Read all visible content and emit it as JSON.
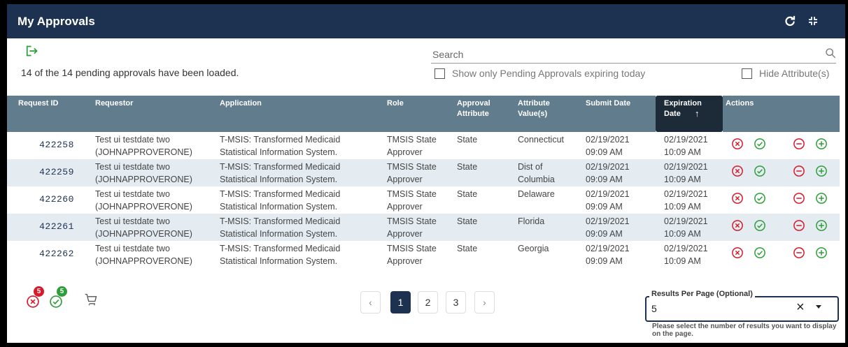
{
  "header": {
    "title": "My Approvals",
    "refresh_icon": "refresh-icon",
    "collapse_icon": "collapse-icon"
  },
  "toolbar": {
    "loaded_text": "14 of the 14 pending approvals have been loaded.",
    "search_placeholder": "Search",
    "search_value": "",
    "expiring_today_label": "Show only Pending Approvals expiring today",
    "expiring_today_checked": false,
    "hide_attributes_label": "Hide Attribute(s)",
    "hide_attributes_checked": false
  },
  "table": {
    "columns": [
      "Request ID",
      "Requestor",
      "Application",
      "Role",
      "Approval Attribute",
      "Attribute Value(s)",
      "Submit Date",
      "Expiration Date",
      "Actions"
    ],
    "sort": {
      "column": "Expiration Date",
      "direction": "ascending",
      "indicator": "↑"
    },
    "rows": [
      {
        "request_id": "422258",
        "requestor_name": "Test ui testdate two",
        "requestor_id": "(JOHNAPPROVERONE)",
        "app_line1": "T-MSIS: Transformed Medicaid",
        "app_line2": "Statistical Information System.",
        "role_line1": "TMSIS State",
        "role_line2": "Approver",
        "approval_attribute": "State",
        "attr_line1": "Connecticut",
        "attr_line2": "",
        "submit_date": "02/19/2021",
        "submit_time": "09:09 AM",
        "exp_date": "02/19/2021",
        "exp_time": "10:09 AM"
      },
      {
        "request_id": "422259",
        "requestor_name": "Test ui testdate two",
        "requestor_id": "(JOHNAPPROVERONE)",
        "app_line1": "T-MSIS: Transformed Medicaid",
        "app_line2": "Statistical Information System.",
        "role_line1": "TMSIS State",
        "role_line2": "Approver",
        "approval_attribute": "State",
        "attr_line1": "Dist of",
        "attr_line2": "Columbia",
        "submit_date": "02/19/2021",
        "submit_time": "09:09 AM",
        "exp_date": "02/19/2021",
        "exp_time": "10:09 AM"
      },
      {
        "request_id": "422260",
        "requestor_name": "Test ui testdate two",
        "requestor_id": "(JOHNAPPROVERONE)",
        "app_line1": "T-MSIS: Transformed Medicaid",
        "app_line2": "Statistical Information System.",
        "role_line1": "TMSIS State",
        "role_line2": "Approver",
        "approval_attribute": "State",
        "attr_line1": "Delaware",
        "attr_line2": "",
        "submit_date": "02/19/2021",
        "submit_time": "09:09 AM",
        "exp_date": "02/19/2021",
        "exp_time": "10:09 AM"
      },
      {
        "request_id": "422261",
        "requestor_name": "Test ui testdate two",
        "requestor_id": "(JOHNAPPROVERONE)",
        "app_line1": "T-MSIS: Transformed Medicaid",
        "app_line2": "Statistical Information System.",
        "role_line1": "TMSIS State",
        "role_line2": "Approver",
        "approval_attribute": "State",
        "attr_line1": "Florida",
        "attr_line2": "",
        "submit_date": "02/19/2021",
        "submit_time": "09:09 AM",
        "exp_date": "02/19/2021",
        "exp_time": "10:09 AM"
      },
      {
        "request_id": "422262",
        "requestor_name": "Test ui testdate two",
        "requestor_id": "(JOHNAPPROVERONE)",
        "app_line1": "T-MSIS: Transformed Medicaid",
        "app_line2": "Statistical Information System.",
        "role_line1": "TMSIS State",
        "role_line2": "Approver",
        "approval_attribute": "State",
        "attr_line1": "Georgia",
        "attr_line2": "",
        "submit_date": "02/19/2021",
        "submit_time": "09:09 AM",
        "exp_date": "02/19/2021",
        "exp_time": "10:09 AM"
      }
    ],
    "row_actions": [
      "reject-icon",
      "approve-icon",
      "remove-icon",
      "add-icon"
    ]
  },
  "footer": {
    "reject_count": "5",
    "approve_count": "5",
    "cart_icon": "cart-icon",
    "pages": [
      "1",
      "2",
      "3"
    ],
    "current_page": "1",
    "prev_label": "‹",
    "next_label": "›",
    "results_per_page": {
      "label": "Results Per Page (Optional)",
      "value": "5",
      "help": "Please select the number of results you want to display on the page."
    }
  },
  "colors": {
    "header": "#1d3251",
    "table_header": "#607c8d",
    "sorted_header": "#1d2a38",
    "alt_row": "#e4ecf2",
    "green": "#2e9e3a",
    "red": "#d8192a"
  }
}
